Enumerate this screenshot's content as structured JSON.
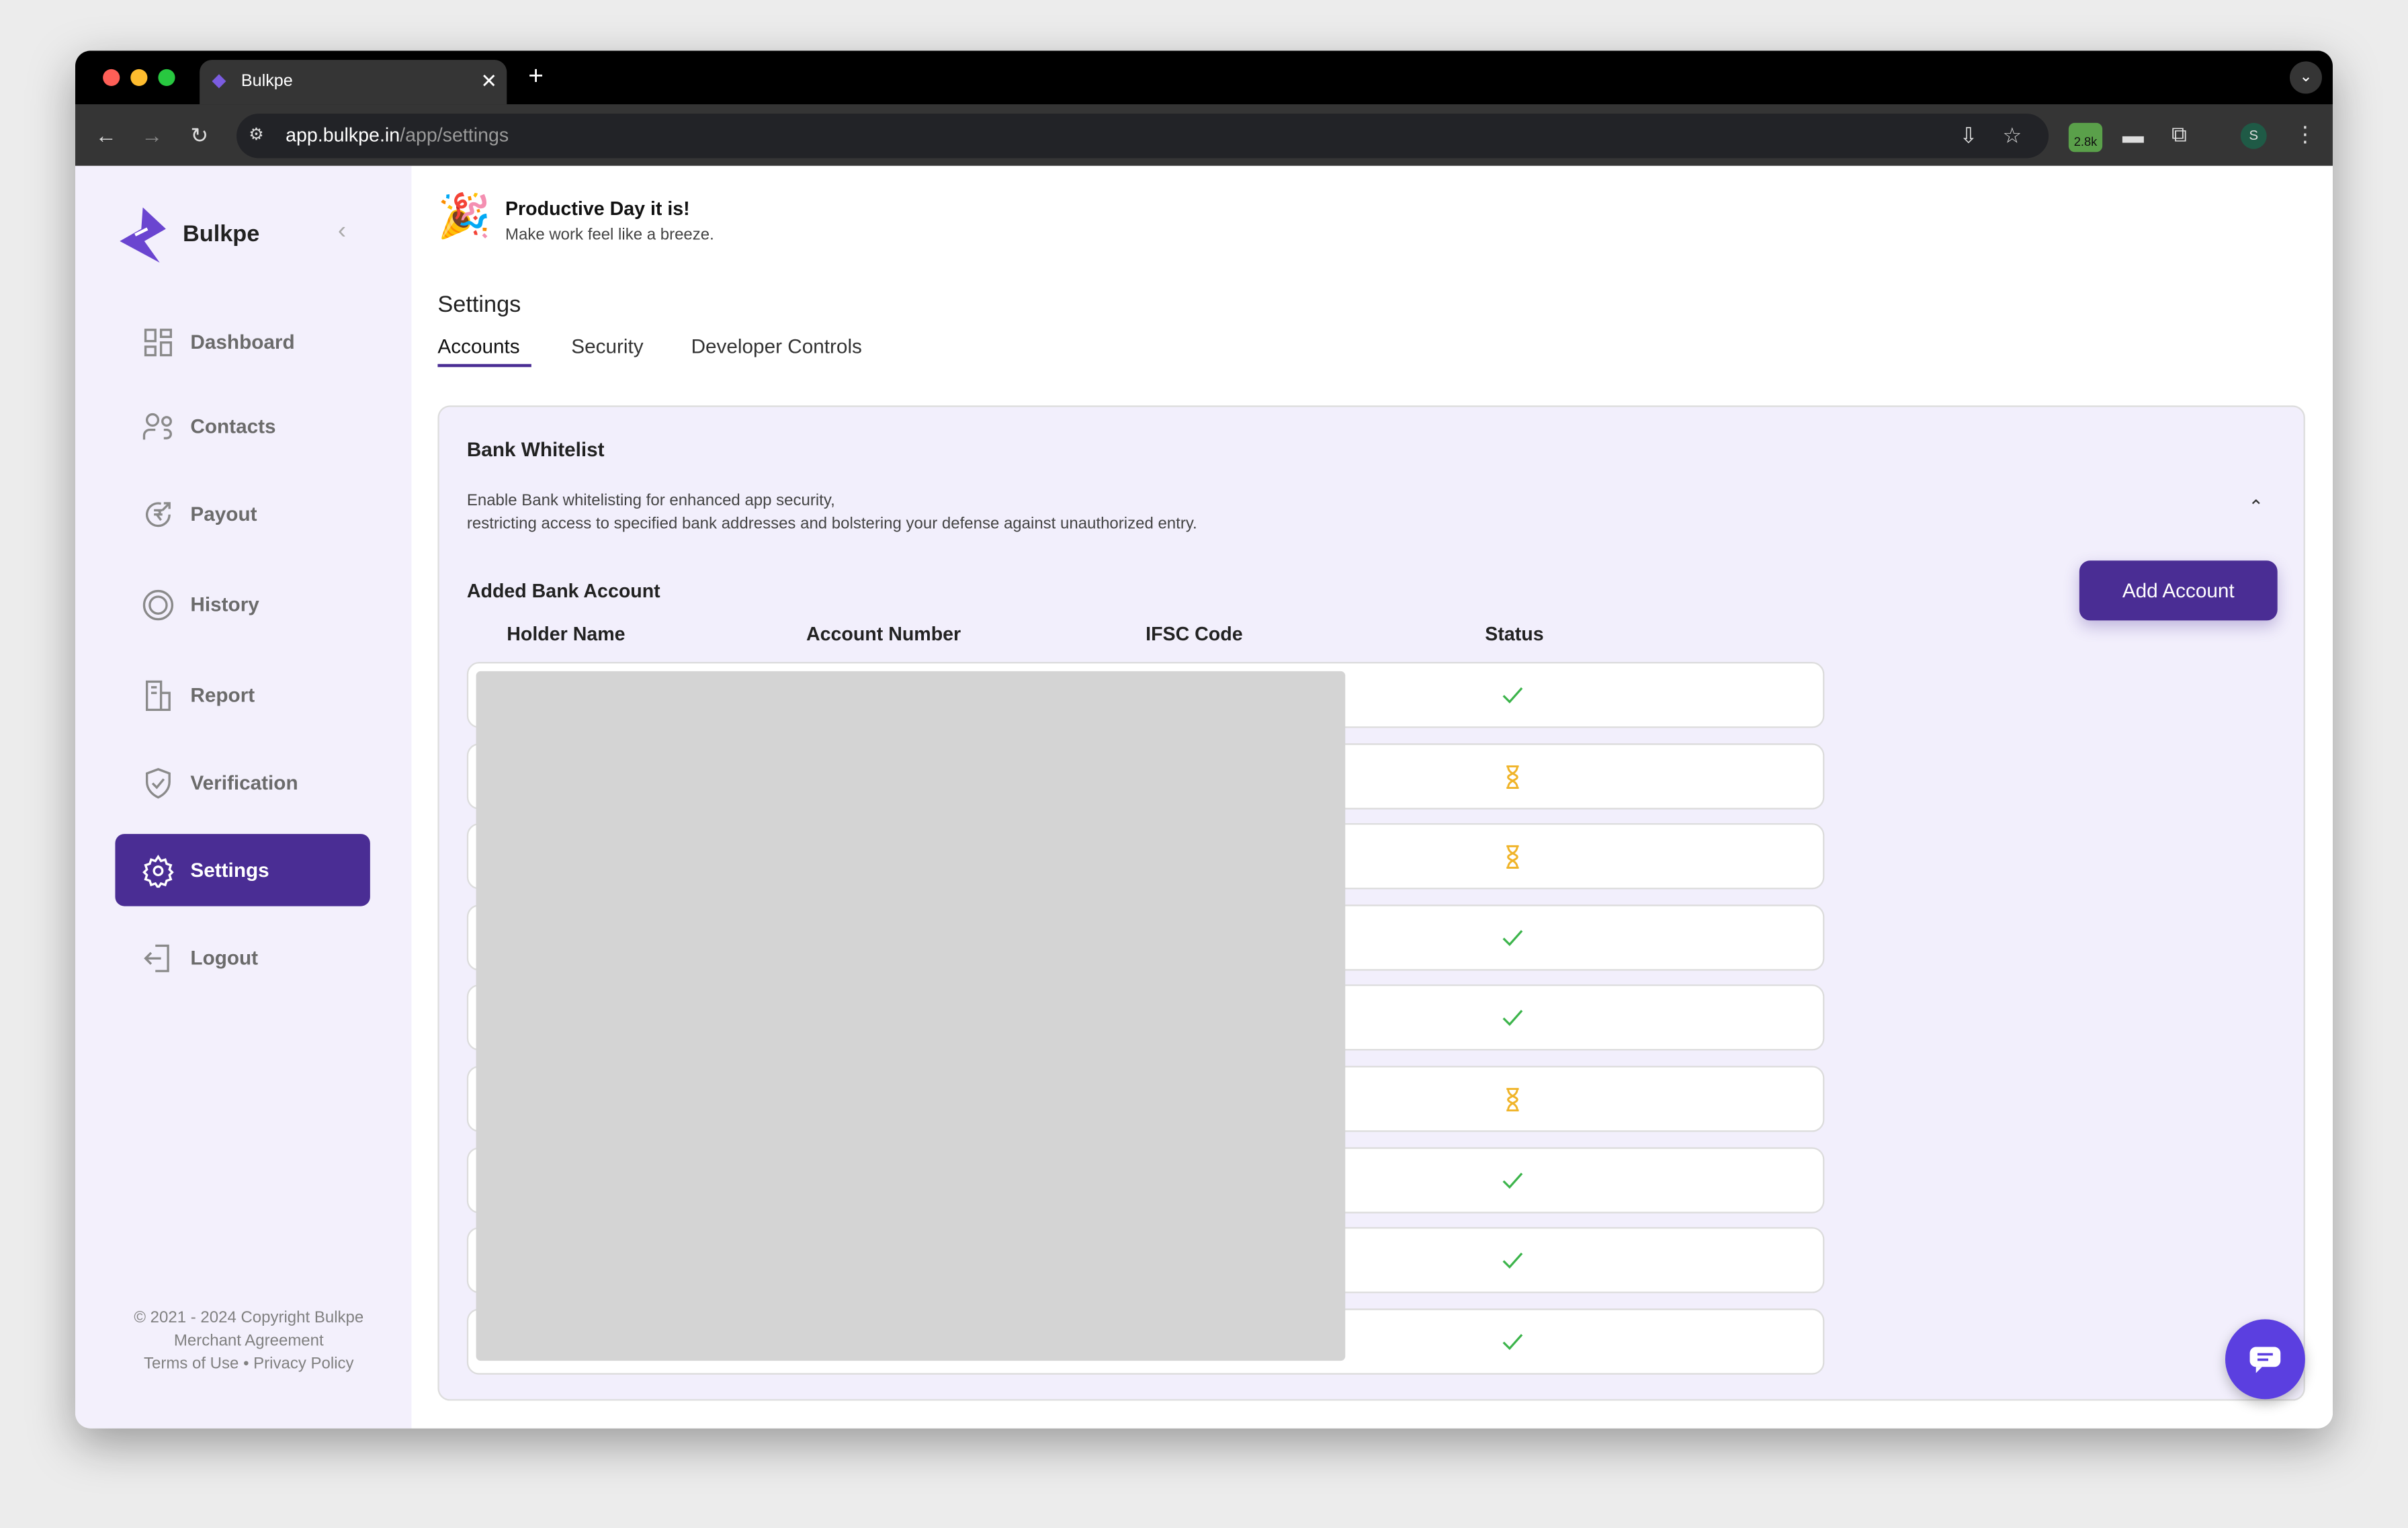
{
  "browser": {
    "tab_title": "Bulkpe",
    "url_host": "app.bulkpe.in",
    "url_path": "/app/settings",
    "extension_badge": "2.8k",
    "profile_initial": "S"
  },
  "sidebar": {
    "brand": "Bulkpe",
    "items": [
      {
        "label": "Dashboard",
        "icon": "dashboard-icon"
      },
      {
        "label": "Contacts",
        "icon": "contacts-icon"
      },
      {
        "label": "Payout",
        "icon": "payout-icon"
      },
      {
        "label": "History",
        "icon": "history-icon"
      },
      {
        "label": "Report",
        "icon": "report-icon"
      },
      {
        "label": "Verification",
        "icon": "shield-check-icon"
      },
      {
        "label": "Settings",
        "icon": "gear-icon",
        "active": true
      },
      {
        "label": "Logout",
        "icon": "logout-icon"
      }
    ],
    "footer": {
      "copyright": "2021 - 2024 Copyright Bulkpe",
      "merchant": "Merchant Agreement",
      "terms": "Terms of Use",
      "sep": "•",
      "privacy": "Privacy Policy"
    }
  },
  "greeting": {
    "title": "Productive Day it is!",
    "subtitle": "Make work feel like a breeze."
  },
  "page": {
    "title": "Settings",
    "tabs": [
      "Accounts",
      "Security",
      "Developer Controls"
    ],
    "active_tab": "Accounts"
  },
  "panel": {
    "title": "Bank Whitelist",
    "desc1": "Enable Bank whitelisting for enhanced app security,",
    "desc2": "restricting access to specified bank addresses and bolstering your defense against unauthorized entry.",
    "section": "Added Bank Account",
    "add_button": "Add Account",
    "columns": [
      "Holder Name",
      "Account Number",
      "IFSC Code",
      "Status"
    ],
    "rows": [
      "verified",
      "pending",
      "pending",
      "verified",
      "verified",
      "pending",
      "verified",
      "verified",
      "verified"
    ]
  },
  "colors": {
    "accent": "#4a2d94",
    "sidebar_bg": "#f3f0fc",
    "verified": "#3cb44b",
    "pending": "#f0b429"
  }
}
